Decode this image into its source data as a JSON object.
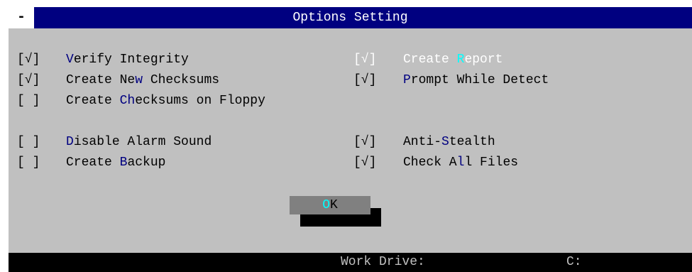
{
  "window": {
    "title": "Options Setting",
    "system_menu": "-"
  },
  "options": [
    {
      "check": "[√]",
      "pre": "",
      "hotkey": "V",
      "post": "erify Integrity",
      "enabled": true
    },
    {
      "check": "[√]",
      "pre": "Create Ne",
      "hotkey": "w",
      "post": " Checksums",
      "enabled": true
    },
    {
      "check": "[ ]",
      "pre": "Create ",
      "hotkey": "Ch",
      "post": "ecksums on Floppy",
      "enabled": true
    },
    {
      "check": "[ ]",
      "pre": "",
      "hotkey": "D",
      "post": "isable Alarm Sound",
      "enabled": true
    },
    {
      "check": "[ ]",
      "pre": "Create ",
      "hotkey": "B",
      "post": "ackup",
      "enabled": true
    },
    {
      "check": "[√]",
      "pre": "Create ",
      "hotkey": "R",
      "post": "eport",
      "enabled": false
    },
    {
      "check": "[√]",
      "pre": "",
      "hotkey": "P",
      "post": "rompt While Detect",
      "enabled": true
    },
    {
      "check": "[√]",
      "pre": "Anti-",
      "hotkey": "S",
      "post": "tealth",
      "enabled": true
    },
    {
      "check": "[√]",
      "pre": "Check A",
      "hotkey": "l",
      "post": "l Files",
      "enabled": true
    }
  ],
  "ok_button": {
    "hotkey": "O",
    "rest": "K"
  },
  "status_bar": {
    "label": "Work Drive:",
    "value": "C:"
  },
  "colors": {
    "title_bar": "#000080",
    "dialog_bg": "#c0c0c0",
    "hotkey": "#000080",
    "dim_text": "#ffffff",
    "dim_hotkey": "#00ffff",
    "button": "#808080",
    "status_bar": "#000000"
  }
}
